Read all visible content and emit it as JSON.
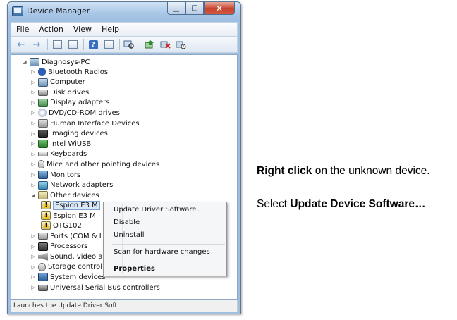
{
  "window": {
    "title": "Device Manager",
    "minimize_glyph": "▁",
    "maximize_glyph": "□",
    "close_glyph": "✕"
  },
  "menubar": [
    "File",
    "Action",
    "View",
    "Help"
  ],
  "toolbar": {
    "back_icon": "←",
    "forward_icon": "→",
    "help_icon": "?"
  },
  "tree": {
    "root": "Diagnosys-PC",
    "items": [
      {
        "label": "Bluetooth Radios",
        "icon": "bluetooth-icon"
      },
      {
        "label": "Computer",
        "icon": "computer-icon"
      },
      {
        "label": "Disk drives",
        "icon": "disk-drive-icon"
      },
      {
        "label": "Display adapters",
        "icon": "display-adapter-icon"
      },
      {
        "label": "DVD/CD-ROM drives",
        "icon": "dvd-icon"
      },
      {
        "label": "Human Interface Devices",
        "icon": "hid-icon"
      },
      {
        "label": "Imaging devices",
        "icon": "camera-icon"
      },
      {
        "label": "Intel WiUSB",
        "icon": "wiusb-icon"
      },
      {
        "label": "Keyboards",
        "icon": "keyboard-icon"
      },
      {
        "label": "Mice and other pointing devices",
        "icon": "mouse-icon"
      },
      {
        "label": "Monitors",
        "icon": "monitor-icon"
      },
      {
        "label": "Network adapters",
        "icon": "network-icon"
      },
      {
        "label": "Other devices",
        "icon": "other-devices-icon"
      }
    ],
    "other_children": [
      "Espion E3 M",
      "Espion E3 M",
      "OTG102"
    ],
    "after_items": [
      {
        "label": "Ports (COM & L",
        "icon": "ports-icon"
      },
      {
        "label": "Processors",
        "icon": "processor-icon"
      },
      {
        "label": "Sound, video ar",
        "icon": "sound-icon"
      },
      {
        "label": "Storage control",
        "icon": "storage-icon"
      },
      {
        "label": "System devices",
        "icon": "system-icon"
      },
      {
        "label": "Universal Serial Bus controllers",
        "icon": "usb-icon"
      }
    ]
  },
  "context_menu": {
    "items": [
      "Update Driver Software...",
      "Disable",
      "Uninstall",
      "Scan for hardware changes",
      "Properties"
    ]
  },
  "status_bar": {
    "text": "Launches the Update Driver Softv"
  },
  "instructions": {
    "line1_bold": "Right click",
    "line1_rest": " on the unknown device.",
    "line2_prefix": "Select ",
    "line2_bold": "Update Device Software…"
  }
}
